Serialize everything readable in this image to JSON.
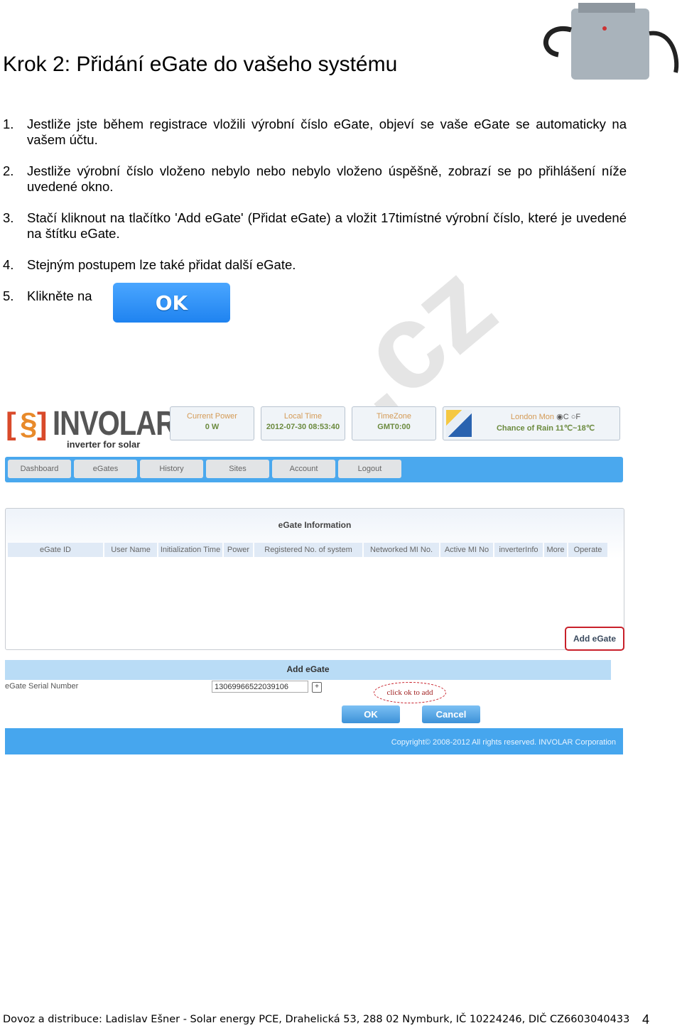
{
  "heading": "Krok 2: Přidání eGate do vašeho systému",
  "steps": [
    {
      "n": "1.",
      "text": "Jestliže jste během registrace vložili výrobní číslo eGate, objeví se vaše eGate se automaticky na vašem účtu."
    },
    {
      "n": "2.",
      "text": "Jestliže výrobní číslo vloženo nebylo nebo nebylo vloženo úspěšně, zobrazí se po přihlášení níže uvedené okno."
    },
    {
      "n": "3.",
      "text": "Stačí kliknout na tlačítko 'Add eGate' (Přidat eGate) a vložit 17timístné výrobní číslo, které je uvedené na štítku eGate."
    },
    {
      "n": "4.",
      "text": "Stejným postupem lze také přidat další eGate."
    },
    {
      "n": "5.",
      "text": "Klikněte na"
    }
  ],
  "ok_image_label": "OK",
  "screenshot": {
    "logo": {
      "name": "INVOLAR",
      "tagline": "inverter for solar"
    },
    "current_power": {
      "label": "Current Power",
      "value": "0 W"
    },
    "local_time": {
      "label": "Local Time",
      "value": "2012-07-30 08:53:40"
    },
    "timezone": {
      "label": "TimeZone",
      "value": "GMT0:00"
    },
    "weather": {
      "city": "London Mon",
      "unit_c": "C",
      "unit_f": "F",
      "forecast": "Chance of Rain 11℃~18℃"
    },
    "nav": [
      "Dashboard",
      "eGates",
      "History",
      "Sites",
      "Account",
      "Logout"
    ],
    "info_title": "eGate Information",
    "columns": [
      "eGate ID",
      "User Name",
      "Initialization Time",
      "Power",
      "Registered No. of system",
      "Networked MI No.",
      "Active MI No",
      "inverterInfo",
      "More",
      "Operate"
    ],
    "add_egate_button": "Add eGate",
    "add_title": "Add eGate",
    "serial_label": "eGate Serial Number",
    "serial_value": "13069966522039106",
    "plus": "+",
    "annotation": "click ok to add",
    "ok": "OK",
    "cancel": "Cancel",
    "copyright": "Copyright© 2008-2012 All rights reserved. INVOLAR Corporation"
  },
  "footer": "Dovoz a distribuce: Ladislav Ešner - Solar energy PCE, Drahelická 53, 288 02 Nymburk, IČ 10224246, DIČ CZ6603040433",
  "page_number": "4"
}
